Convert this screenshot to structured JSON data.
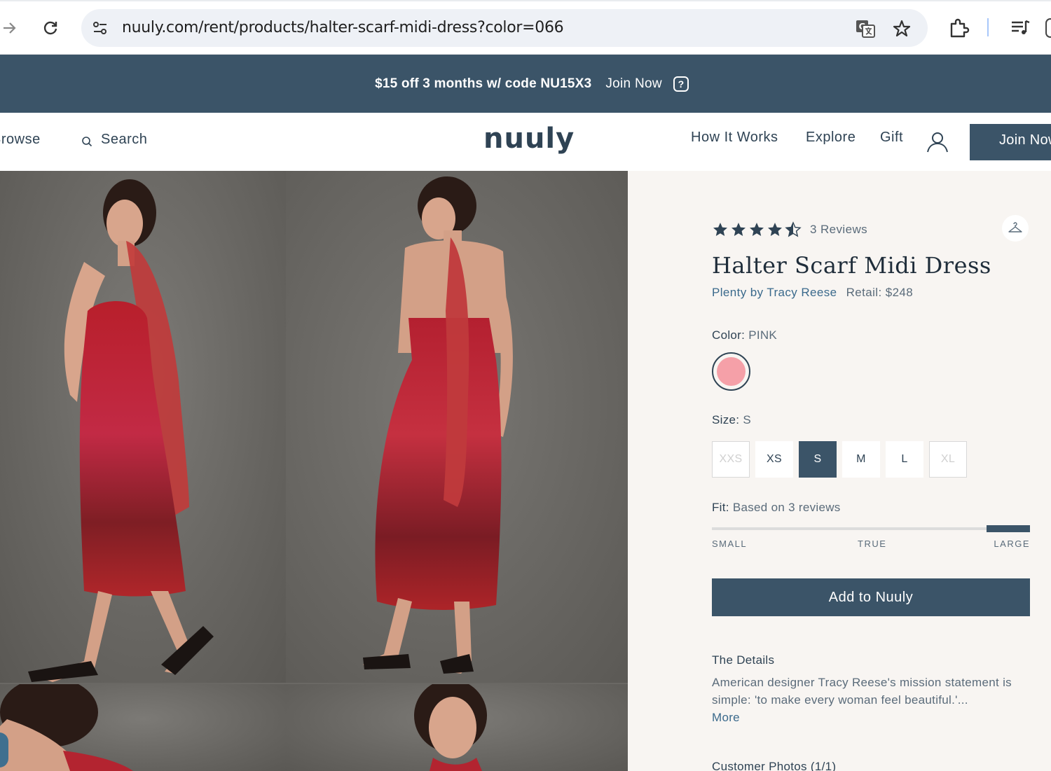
{
  "browser": {
    "url": "nuuly.com/rent/products/halter-scarf-midi-dress?color=066"
  },
  "promo": {
    "code_text": "$15 off 3 months w/ code NU15X3",
    "join_label": "Join Now",
    "help_symbol": "?"
  },
  "header": {
    "browse_label": "Browse",
    "search_label": "Search",
    "logo": "nuuly",
    "nav": [
      "How It Works",
      "Explore",
      "Gift"
    ],
    "join_label": "Join Now"
  },
  "product": {
    "rating": 4.5,
    "reviews_label": "3 Reviews",
    "title": "Halter Scarf Midi Dress",
    "brand": "Plenty by Tracy Reese",
    "retail": "Retail: $248",
    "color_label": "Color:",
    "color_value": "PINK",
    "swatch_color": "#f5a0a8",
    "size_label": "Size:",
    "size_value": "S",
    "sizes": [
      {
        "label": "XXS",
        "state": "disabled"
      },
      {
        "label": "XS",
        "state": "available"
      },
      {
        "label": "S",
        "state": "selected"
      },
      {
        "label": "M",
        "state": "available"
      },
      {
        "label": "L",
        "state": "available"
      },
      {
        "label": "XL",
        "state": "disabled"
      }
    ],
    "fit_label": "Fit:",
    "fit_value": "Based on 3 reviews",
    "fit_scale": [
      "SMALL",
      "TRUE",
      "LARGE"
    ],
    "fit_position": 0.87,
    "add_label": "Add to Nuuly",
    "details_heading": "The Details",
    "details_text": "American designer Tracy Reese's mission statement is simple: 'to make every woman feel beautiful.'...",
    "more_label": "More",
    "customer_photos_label": "Customer Photos (1/1)"
  },
  "colors": {
    "brand_navy": "#3b5468",
    "panel_bg": "#f8f5f2",
    "link_blue": "#3b6a8c"
  }
}
